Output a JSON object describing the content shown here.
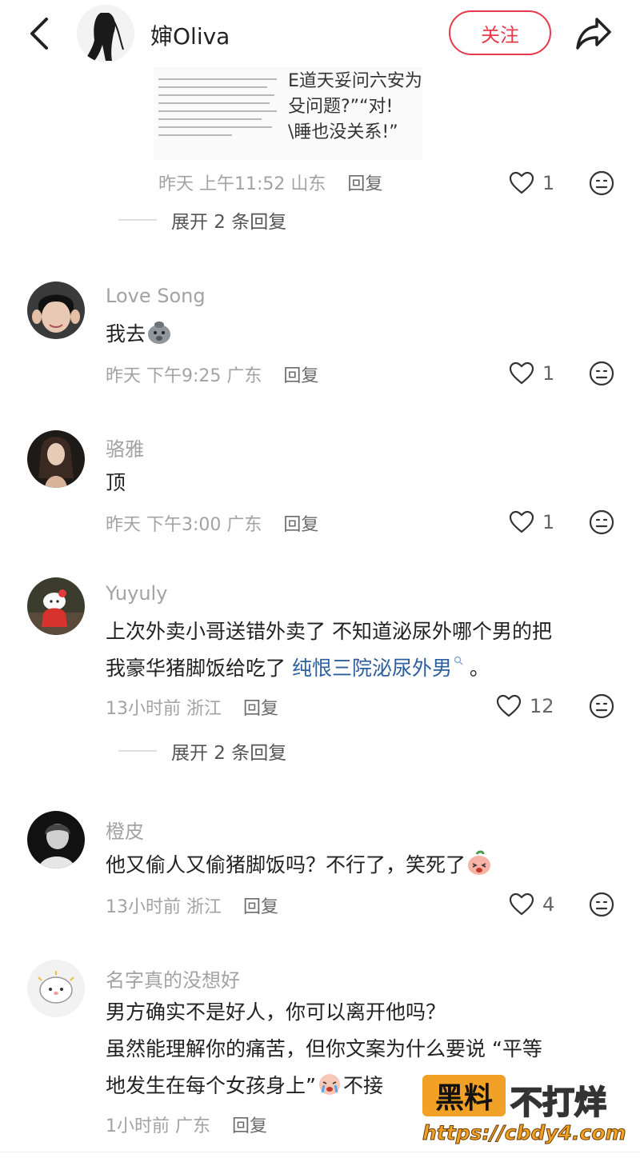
{
  "header": {
    "back_icon": "chevron-left-icon",
    "author_name": "婶Oliva",
    "follow_label": "关注",
    "share_icon": "share-arrow-icon",
    "accent_color": "#e8394a"
  },
  "image_preview": {
    "right_lines": [
      "E道天妥问六安为",
      "殳问题?”“对!",
      "\\睡也没关系!”"
    ]
  },
  "first_comment": {
    "time": "昨天 上午11:52",
    "location": "山东",
    "reply_label": "回复",
    "likes": "1",
    "expand_label": "展开 2 条回复"
  },
  "comments": [
    {
      "name": "Love Song",
      "text": "我去",
      "time": "昨天 下午9:25",
      "location": "广东",
      "reply_label": "回复",
      "likes": "1"
    },
    {
      "name": "骆雅",
      "text": "顶",
      "time": "昨天 下午3:00",
      "location": "广东",
      "reply_label": "回复",
      "likes": "1"
    },
    {
      "name": "Yuyuly",
      "line1": "上次外卖小哥送错外卖了 不知道泌尿外哪个男的把",
      "line2_prefix": "我豪华猪脚饭给吃了 ",
      "line2_link": "纯恨三院泌尿外男",
      "line2_suffix": " 。",
      "time": "13小时前",
      "location": "浙江",
      "reply_label": "回复",
      "likes": "12",
      "expand_label": "展开 2 条回复"
    },
    {
      "name": "橙皮",
      "text": "他又偷人又偷猪脚饭吗？不行了，笑死了",
      "time": "13小时前",
      "location": "浙江",
      "reply_label": "回复",
      "likes": "4"
    },
    {
      "name": "名字真的没想好",
      "line1": "男方确实不是好人，你可以离开他吗？",
      "line2": "虽然能理解你的痛苦，但你文案为什么要说 “平等",
      "line3_prefix": "地发生在每个女孩身上”",
      "line3_suffix": "不接",
      "time": "1小时前",
      "location": "广东",
      "reply_label": "回复"
    }
  ],
  "watermark": {
    "badge": "黑料",
    "text": "不打烊",
    "url": "https://cbdy4.com"
  }
}
